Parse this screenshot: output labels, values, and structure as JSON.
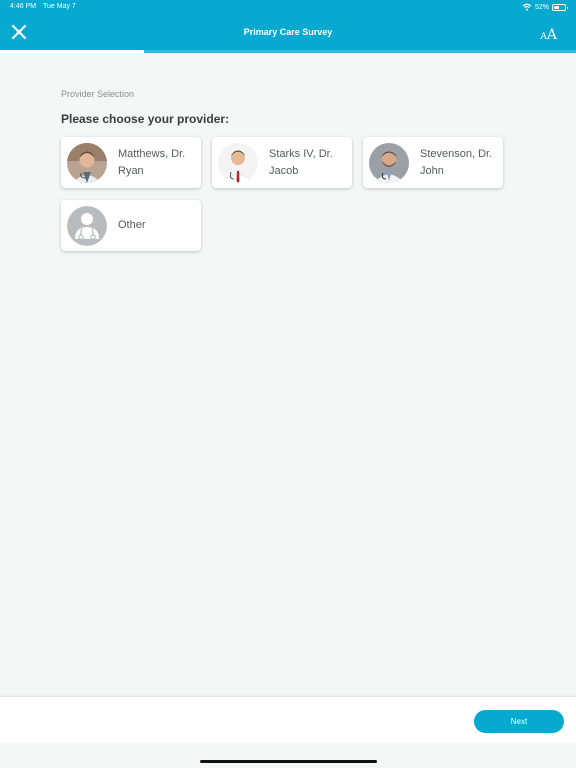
{
  "status_bar": {
    "time": "4:46 PM",
    "date": "Tue May 7",
    "battery": "52%",
    "battery_level": 0.52
  },
  "header": {
    "title": "Primary Care Survey",
    "text_size_small": "A",
    "text_size_large": "A",
    "progress": 0.25
  },
  "section_label": "Provider Selection",
  "question": "Please choose your provider:",
  "providers": [
    {
      "line1": "Matthews, Dr.",
      "line2": "Ryan"
    },
    {
      "line1": "Starks IV, Dr.",
      "line2": "Jacob"
    },
    {
      "line1": "Stevenson, Dr.",
      "line2": "John"
    },
    {
      "line1": "Other",
      "line2": ""
    }
  ],
  "footer": {
    "next_label": "Next"
  },
  "colors": {
    "accent": "#08a9d0",
    "background": "#f5f6f6"
  },
  "icons": {
    "close": "close-icon",
    "wifi": "wifi-icon",
    "battery": "battery-icon",
    "text_size": "text-size-icon",
    "placeholder_avatar": "doctor-placeholder-icon"
  }
}
